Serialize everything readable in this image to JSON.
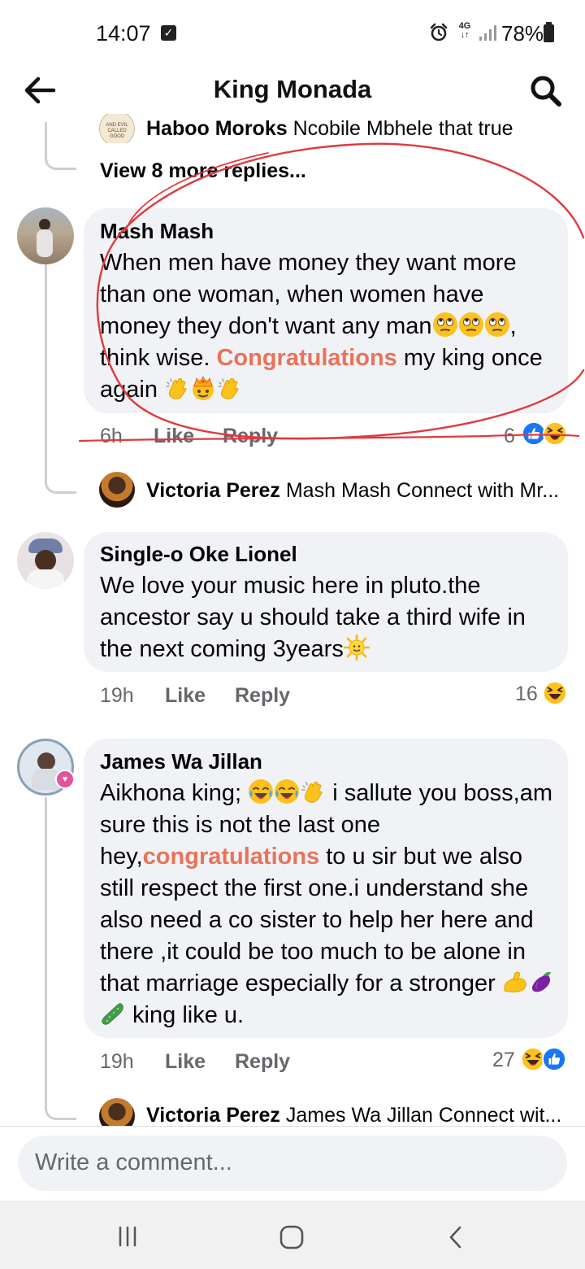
{
  "status_bar": {
    "time": "14:07",
    "network": "4G",
    "battery": "78%"
  },
  "header": {
    "title": "King Monada"
  },
  "top_thread": {
    "partial_reply_author": "Haboo Moroks",
    "partial_reply_text": "Ncobile Mbhele that true",
    "view_more": "View 8 more replies..."
  },
  "comments": [
    {
      "author": "Mash Mash",
      "text_1": "When men have money they want more than one woman, when women have money they don't want any man",
      "text_2": ", think wise. ",
      "highlight": "Congratulations",
      "text_3": " my  king once again ",
      "time": "6h",
      "like": "Like",
      "reply": "Reply",
      "reaction_count": "6",
      "reply_preview": {
        "author": "Victoria Perez",
        "text": "Mash Mash Connect with Mr..."
      }
    },
    {
      "author": "Single-o Oke Lionel",
      "text_1": "We love your music here in pluto.the ancestor say u should take a third wife in the next coming 3years",
      "time": "19h",
      "like": "Like",
      "reply": "Reply",
      "reaction_count": "16"
    },
    {
      "author": "James Wa Jillan",
      "text_1": "Aikhona king; ",
      "text_2": " i sallute you boss,am sure this is not the last one hey,",
      "highlight": "congratulations",
      "text_3": " to u sir but we also still respect the first one.i understand she also need a co sister to help her here and there ,it could be too much to be alone in that  marriage especially for a stronger ",
      "text_4": " king like u.",
      "time": "19h",
      "like": "Like",
      "reply": "Reply",
      "reaction_count": "27",
      "reply_preview": {
        "author": "Victoria Perez",
        "text": "James Wa Jillan Connect wit..."
      }
    }
  ],
  "composer": {
    "placeholder": "Write a comment..."
  },
  "icons": {
    "back": "back-arrow-icon",
    "search": "search-icon",
    "eye_roll_emoji": "eye-roll-emoji-icon",
    "clap_emoji": "clapping-hands-emoji-icon",
    "crown_emoji": "crown-emoji-icon",
    "sun_emoji": "sun-face-emoji-icon",
    "tears_joy_emoji": "tears-of-joy-emoji-icon",
    "muscle_emoji": "flexed-biceps-emoji-icon",
    "eggplant_emoji": "eggplant-emoji-icon",
    "cucumber_emoji": "cucumber-emoji-icon",
    "like_reaction": "like-reaction-icon",
    "haha_reaction": "haha-reaction-icon"
  },
  "colors": {
    "highlight": "#e8735a",
    "bubble": "#f0f2f5",
    "like_blue": "#1877f2",
    "annotation_red": "#e0393e"
  }
}
